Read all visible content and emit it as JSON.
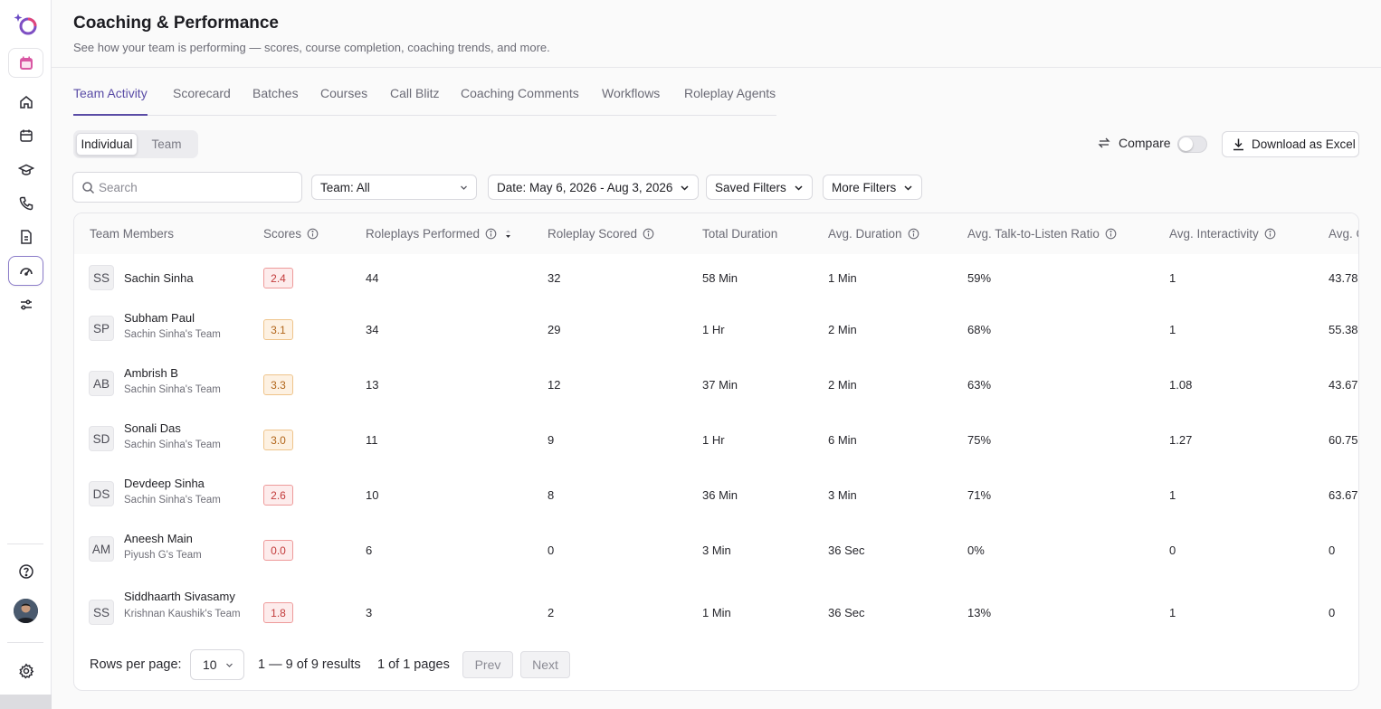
{
  "header": {
    "title": "Coaching & Performance",
    "subtitle": "See how your team is performing — scores, course completion, coaching trends, and more."
  },
  "tabs": [
    {
      "label": "Team Activity",
      "active": true
    },
    {
      "label": "Scorecard"
    },
    {
      "label": "Batches"
    },
    {
      "label": "Courses"
    },
    {
      "label": "Call Blitz"
    },
    {
      "label": "Coaching Comments"
    },
    {
      "label": "Workflows"
    },
    {
      "label": "Roleplay Agents"
    }
  ],
  "view_toggle": {
    "individual": "Individual",
    "team": "Team",
    "selected": "Individual"
  },
  "compare": {
    "label": "Compare",
    "enabled": false
  },
  "download_label": "Download as Excel",
  "search": {
    "placeholder": "Search",
    "value": ""
  },
  "filters": {
    "team": "Team: All",
    "date": "Date: May 6, 2026 - Aug 3, 2026",
    "saved": "Saved Filters",
    "more": "More Filters"
  },
  "table": {
    "columns": [
      "Team Members",
      "Scores",
      "Roleplays Performed",
      "Roleplay Scored",
      "Total Duration",
      "Avg. Duration",
      "Avg. Talk-to-Listen Ratio",
      "Avg. Interactivity",
      "Avg. C"
    ],
    "rows": [
      {
        "initials": "SS",
        "name": "Sachin Sinha",
        "team": "",
        "score": "2.4",
        "score_level": "red",
        "performed": "44",
        "scored": "32",
        "total": "58 Min",
        "avg": "1 Min",
        "ratio": "59%",
        "interactivity": "1",
        "avg_c": "43.78"
      },
      {
        "initials": "SP",
        "name": "Subham Paul",
        "team": "Sachin Sinha's Team",
        "score": "3.1",
        "score_level": "orange",
        "performed": "34",
        "scored": "29",
        "total": "1 Hr",
        "avg": "2 Min",
        "ratio": "68%",
        "interactivity": "1",
        "avg_c": "55.38"
      },
      {
        "initials": "AB",
        "name": "Ambrish B",
        "team": "Sachin Sinha's Team",
        "score": "3.3",
        "score_level": "orange",
        "performed": "13",
        "scored": "12",
        "total": "37 Min",
        "avg": "2 Min",
        "ratio": "63%",
        "interactivity": "1.08",
        "avg_c": "43.67"
      },
      {
        "initials": "SD",
        "name": "Sonali Das",
        "team": "Sachin Sinha's Team",
        "score": "3.0",
        "score_level": "orange",
        "performed": "11",
        "scored": "9",
        "total": "1 Hr",
        "avg": "6 Min",
        "ratio": "75%",
        "interactivity": "1.27",
        "avg_c": "60.75"
      },
      {
        "initials": "DS",
        "name": "Devdeep Sinha",
        "team": "Sachin Sinha's Team",
        "score": "2.6",
        "score_level": "red",
        "performed": "10",
        "scored": "8",
        "total": "36 Min",
        "avg": "3 Min",
        "ratio": "71%",
        "interactivity": "1",
        "avg_c": "63.67"
      },
      {
        "initials": "AM",
        "name": "Aneesh Main",
        "team": "Piyush G's Team",
        "score": "0.0",
        "score_level": "red",
        "performed": "6",
        "scored": "0",
        "total": "3 Min",
        "avg": "36 Sec",
        "ratio": "0%",
        "interactivity": "0",
        "avg_c": "0"
      },
      {
        "initials": "SS",
        "name": "Siddhaarth Sivasamy",
        "team": "Krishnan Kaushik's Team",
        "score": "1.8",
        "score_level": "red",
        "performed": "3",
        "scored": "2",
        "total": "1 Min",
        "avg": "36 Sec",
        "ratio": "13%",
        "interactivity": "1",
        "avg_c": "0"
      }
    ]
  },
  "pagination": {
    "rows_label": "Rows per page:",
    "rows_value": "10",
    "results": "1 — 9 of 9 results",
    "pages": "1 of 1 pages",
    "prev": "Prev",
    "next": "Next"
  },
  "colors": {
    "accent": "#5a4ca6",
    "score_red": "#c23a3a",
    "score_orange": "#b1651a"
  },
  "sidebar_icons": [
    "app-logo-icon",
    "calendar-app-icon",
    "home-icon",
    "calendar-icon",
    "graduation-cap-icon",
    "phone-icon",
    "document-icon",
    "coaching-gauge-icon",
    "sliders-icon",
    "help-icon",
    "user-avatar",
    "settings-icon"
  ]
}
